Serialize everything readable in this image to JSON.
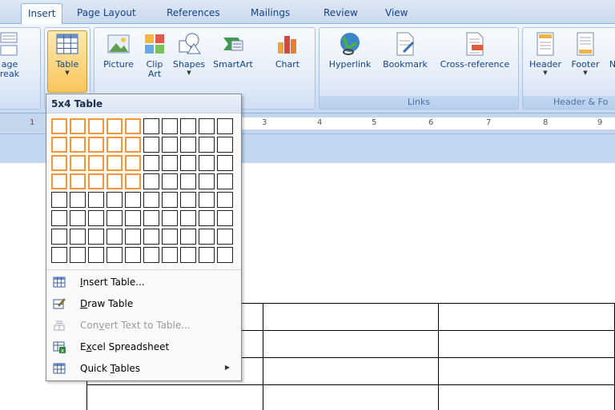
{
  "tabs": [
    "Insert",
    "Page Layout",
    "References",
    "Mailings",
    "Review",
    "View"
  ],
  "ribbon": {
    "page_break": [
      "age",
      "reak"
    ],
    "table_label": "Table",
    "picture_label": "Picture",
    "clipart_label": [
      "Clip",
      "Art"
    ],
    "shapes_label": "Shapes",
    "smartart_label": "SmartArt",
    "chart_label": "Chart",
    "hyperlink_label": "Hyperlink",
    "bookmark_label": "Bookmark",
    "crossref_label": "Cross-reference",
    "header_label": "Header",
    "footer_label": "Footer",
    "cut_label": "N",
    "links_group": "Links",
    "header_group": "Header & Fo"
  },
  "ruler": [
    "1",
    "3",
    "4",
    "5",
    "6",
    "7",
    "8",
    "9"
  ],
  "dropdown": {
    "title": "5x4 Table",
    "grid_cols": 10,
    "grid_rows": 8,
    "selected_cols": 5,
    "selected_rows": 4,
    "items": [
      {
        "pre": "",
        "ul": "I",
        "post": "nsert Table...",
        "disabled": false,
        "icon": "insert-table-icon"
      },
      {
        "pre": "",
        "ul": "D",
        "post": "raw Table",
        "disabled": false,
        "icon": "draw-table-icon"
      },
      {
        "pre": "Con",
        "ul": "v",
        "post": "ert Text to Table...",
        "disabled": true,
        "icon": "convert-text-icon"
      },
      {
        "pre": "E",
        "ul": "x",
        "post": "cel Spreadsheet",
        "disabled": false,
        "icon": "excel-spreadsheet-icon"
      },
      {
        "pre": "Quick ",
        "ul": "T",
        "post": "ables",
        "disabled": false,
        "icon": "quick-tables-icon",
        "submenu": "▶"
      }
    ]
  },
  "colors": {
    "selection_border": "#f39539",
    "ribbon_text": "#15428b"
  }
}
